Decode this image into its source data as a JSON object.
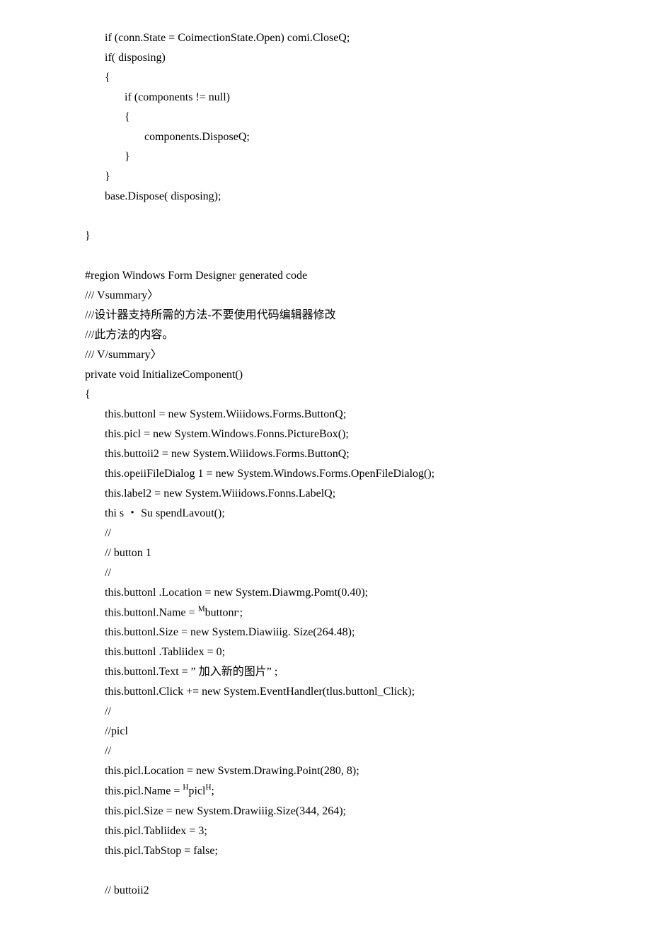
{
  "lines": [
    {
      "text": "if (conn.State = CoimectionState.Open) comi.CloseQ;",
      "indent": 1
    },
    {
      "text": "if( disposing)",
      "indent": 1
    },
    {
      "text": "{",
      "indent": 1
    },
    {
      "text": "if (components != null)",
      "indent": 2
    },
    {
      "text": "{",
      "indent": 2
    },
    {
      "text": "components.DisposeQ;",
      "indent": 3
    },
    {
      "text": "}",
      "indent": 2
    },
    {
      "text": "}",
      "indent": 1
    },
    {
      "text": "base.Dispose( disposing);",
      "indent": 1
    },
    {
      "spacer": true
    },
    {
      "text": "}",
      "indent": 0
    },
    {
      "spacer": true
    },
    {
      "text": "#region Windows Form Designer generated code",
      "indent": 0
    },
    {
      "text": "/// Vsummary〉",
      "indent": 0
    },
    {
      "text": "///设计器支持所需的方法-不要使用代码编辑器修改",
      "indent": 0
    },
    {
      "text": "///此方法的内容。",
      "indent": 0
    },
    {
      "text": "/// V/summary〉",
      "indent": 0
    },
    {
      "text": "private void InitializeComponent()",
      "indent": 0
    },
    {
      "text": "{",
      "indent": 0
    },
    {
      "text": "this.buttonl = new System.Wiiidows.Forms.ButtonQ;",
      "indent": 1
    },
    {
      "text": "this.picl = new System.Windows.Fonns.PictureBox();",
      "indent": 1
    },
    {
      "text": "this.buttoii2 = new System.Wiiidows.Forms.ButtonQ;",
      "indent": 1
    },
    {
      "text": "this.opeiiFileDialog 1 = new System.Windows.Forms.OpenFileDialog();",
      "indent": 1
    },
    {
      "text": "this.label2 = new System.Wiiidows.Fonns.LabelQ;",
      "indent": 1
    },
    {
      "text": "thi s ・ Su spendLavout();",
      "indent": 1
    },
    {
      "text": "//",
      "indent": 1
    },
    {
      "text": "// button 1",
      "indent": 1
    },
    {
      "text": "//",
      "indent": 1
    },
    {
      "text": "this.buttonl .Location = new System.Diawmg.Pomt(0.40);",
      "indent": 1
    },
    {
      "html": "this.buttonl.Name = <sup>M</sup>buttonr<sup>,</sup>;",
      "indent": 1
    },
    {
      "text": "this.buttonl.Size = new System.Diawiiig. Size(264.48);",
      "indent": 1
    },
    {
      "text": "this.buttonl .Tabliidex = 0;",
      "indent": 1
    },
    {
      "text": "this.buttonl.Text = ” 加入新的图片” ;",
      "indent": 1
    },
    {
      "text": "this.buttonl.Click += new System.EventHandler(tlus.buttonl_Click);",
      "indent": 1
    },
    {
      "text": "//",
      "indent": 1
    },
    {
      "text": "//picl",
      "indent": 1
    },
    {
      "text": "//",
      "indent": 1
    },
    {
      "text": "this.picl.Location = new Svstem.Drawing.Point(280, 8);",
      "indent": 1
    },
    {
      "html": "this.picl.Name = <sup>H</sup>picl<sup>H</sup>;",
      "indent": 1
    },
    {
      "text": "this.picl.Size = new System.Drawiiig.Size(344, 264);",
      "indent": 1
    },
    {
      "text": "this.picl.Tabliidex = 3;",
      "indent": 1
    },
    {
      "text": "this.picl.TabStop = false;",
      "indent": 1
    },
    {
      "spacer": true
    },
    {
      "text": "// buttoii2",
      "indent": 1
    }
  ]
}
